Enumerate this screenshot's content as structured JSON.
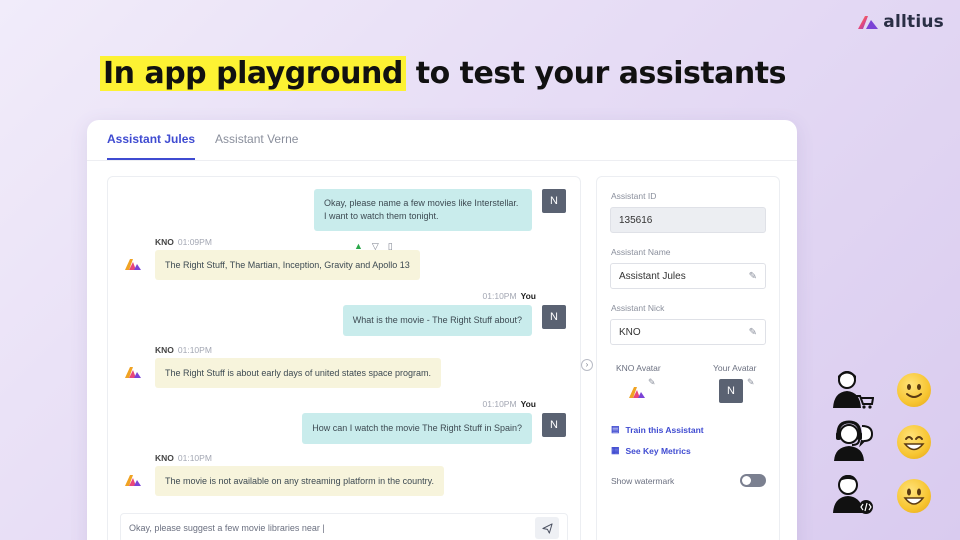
{
  "brand": {
    "name": "alltius"
  },
  "headline": {
    "highlight": "In app playground",
    "rest": " to test your assistants"
  },
  "tabs": [
    {
      "label": "Assistant Jules",
      "active": true
    },
    {
      "label": "Assistant Verne",
      "active": false
    }
  ],
  "chat": {
    "messages": [
      {
        "from": "user",
        "text_line1": "Okay, please name a few movies like Interstellar.",
        "text_line2": "I want to watch them tonight.",
        "avatar": "N"
      },
      {
        "from": "bot",
        "sender": "KNO",
        "time": "01:09PM",
        "text": "The Right Stuff, The Martian, Inception, Gravity and Apollo 13"
      },
      {
        "from": "user",
        "time": "01:10PM",
        "sender": "You",
        "text": "What is the movie - The Right Stuff about?",
        "avatar": "N"
      },
      {
        "from": "bot",
        "sender": "KNO",
        "time": "01:10PM",
        "text": "The Right Stuff is about early days of united states space program."
      },
      {
        "from": "user",
        "time": "01:10PM",
        "sender": "You",
        "text": "How can I watch the movie The Right Stuff in Spain?",
        "avatar": "N"
      },
      {
        "from": "bot",
        "sender": "KNO",
        "time": "01:10PM",
        "text": "The movie is not available on any streaming platform in the country."
      }
    ],
    "input_value": "Okay, please suggest a few movie libraries near |"
  },
  "panel": {
    "assistant_id_label": "Assistant ID",
    "assistant_id": "135616",
    "assistant_name_label": "Assistant Name",
    "assistant_name": "Assistant Jules",
    "assistant_nick_label": "Assistant Nick",
    "assistant_nick": "KNO",
    "kno_avatar_label": "KNO Avatar",
    "your_avatar_label": "Your Avatar",
    "your_avatar": "N",
    "train_link": "Train this Assistant",
    "metrics_link": "See Key Metrics",
    "watermark_label": "Show watermark",
    "watermark_on": false
  },
  "colors": {
    "accent": "#3f4bd1",
    "highlight": "#fdf233",
    "user_bubble": "#c9ecec",
    "bot_bubble": "#f7f4dc"
  },
  "side_icons": [
    {
      "persona": "shopper-icon",
      "emoji": "slight-smile-emoji"
    },
    {
      "persona": "support-agent-icon",
      "emoji": "grin-emoji"
    },
    {
      "persona": "developer-icon",
      "emoji": "big-smile-emoji"
    }
  ]
}
